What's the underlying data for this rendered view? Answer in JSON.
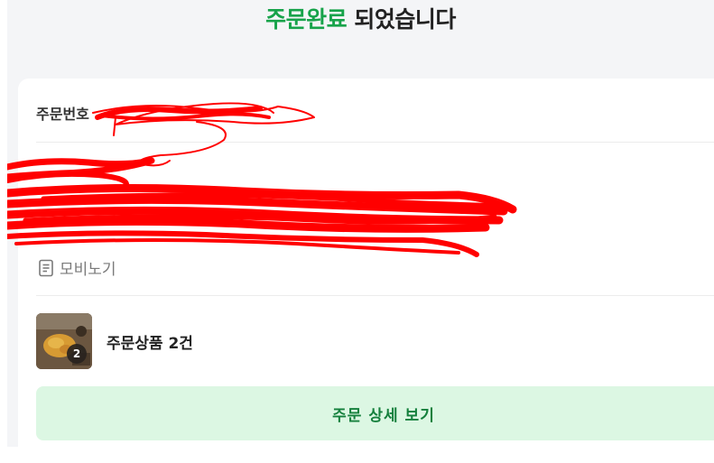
{
  "header": {
    "title_accent": "주문완료",
    "title_rest": " 되었습니다"
  },
  "order": {
    "number_label": "주문번호"
  },
  "memo": {
    "icon": "document-icon",
    "label": "모비노기"
  },
  "product": {
    "summary": "주문상품 2건",
    "badge_count": "2"
  },
  "actions": {
    "detail_button": "주문 상세 보기"
  },
  "colors": {
    "accent": "#17a34a",
    "button_bg": "#dcf7e3",
    "button_text": "#15803d",
    "background": "#f4f5f7",
    "redaction": "#ff0000"
  }
}
